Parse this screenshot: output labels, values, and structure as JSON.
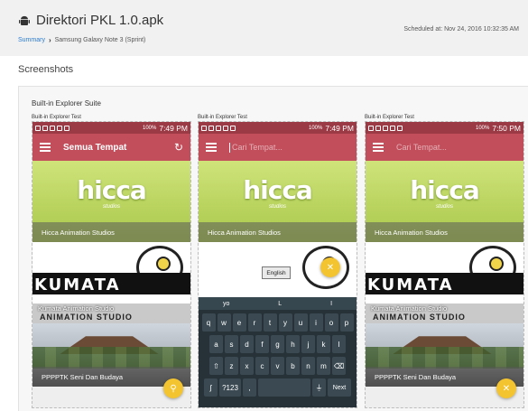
{
  "header": {
    "app_title": "Direktori PKL 1.0.apk",
    "breadcrumb": {
      "summary": "Summary",
      "device": "Samsung Galaxy Note 3 (Sprint)"
    },
    "scheduled": "Scheduled at: Nov 24, 2016 10:32:35 AM"
  },
  "section_title": "Screenshots",
  "suite_title": "Built-in Explorer Suite",
  "screenshots": [
    {
      "label": "Built-in Explorer Test",
      "status": {
        "time": "7:49 PM",
        "battery": "100%"
      },
      "toolbar_title": "Semua Tempat",
      "cards": [
        "Hicca Animation Studios",
        "Kumata Animation Studio",
        "PPPPTK Seni Dan Budaya"
      ]
    },
    {
      "label": "Built-in Explorer Test",
      "status": {
        "time": "7:49 PM",
        "battery": "100%"
      },
      "search_placeholder": "Cari Tempat...",
      "cards": [
        "Hicca Animation Studios"
      ],
      "keyboard": {
        "language_tip": "English",
        "suggestions": [
          "yo",
          "L",
          "I"
        ],
        "row1": [
          "q",
          "w",
          "e",
          "r",
          "t",
          "y",
          "u",
          "i",
          "o",
          "p"
        ],
        "row2": [
          "a",
          "s",
          "d",
          "f",
          "g",
          "h",
          "j",
          "k",
          "l"
        ],
        "row3": [
          "z",
          "x",
          "c",
          "v",
          "b",
          "n",
          "m"
        ],
        "sym": "?123",
        "next": "Next"
      }
    },
    {
      "label": "Built-in Explorer Test",
      "status": {
        "time": "7:50 PM",
        "battery": "100%"
      },
      "search_placeholder": "Cari Tempat...",
      "cards": [
        "Hicca Animation Studios",
        "Kumata Animation Studio",
        "PPPPTK Seni Dan Budaya"
      ]
    }
  ],
  "hicca_logo": {
    "main": "hicca",
    "sub": "studios"
  },
  "kumata_logo": {
    "main": "KUMATA",
    "sub": "ANIMATION STUDIO"
  },
  "colors": {
    "statusbar": "#9b3a45",
    "toolbar": "#c24e5b",
    "fab": "#f4c430",
    "link": "#2b7bd0"
  },
  "icons": {
    "app": "android-icon",
    "menu": "hamburger-menu-icon",
    "refresh": "refresh-icon",
    "search": "search-icon",
    "close": "close-icon"
  }
}
